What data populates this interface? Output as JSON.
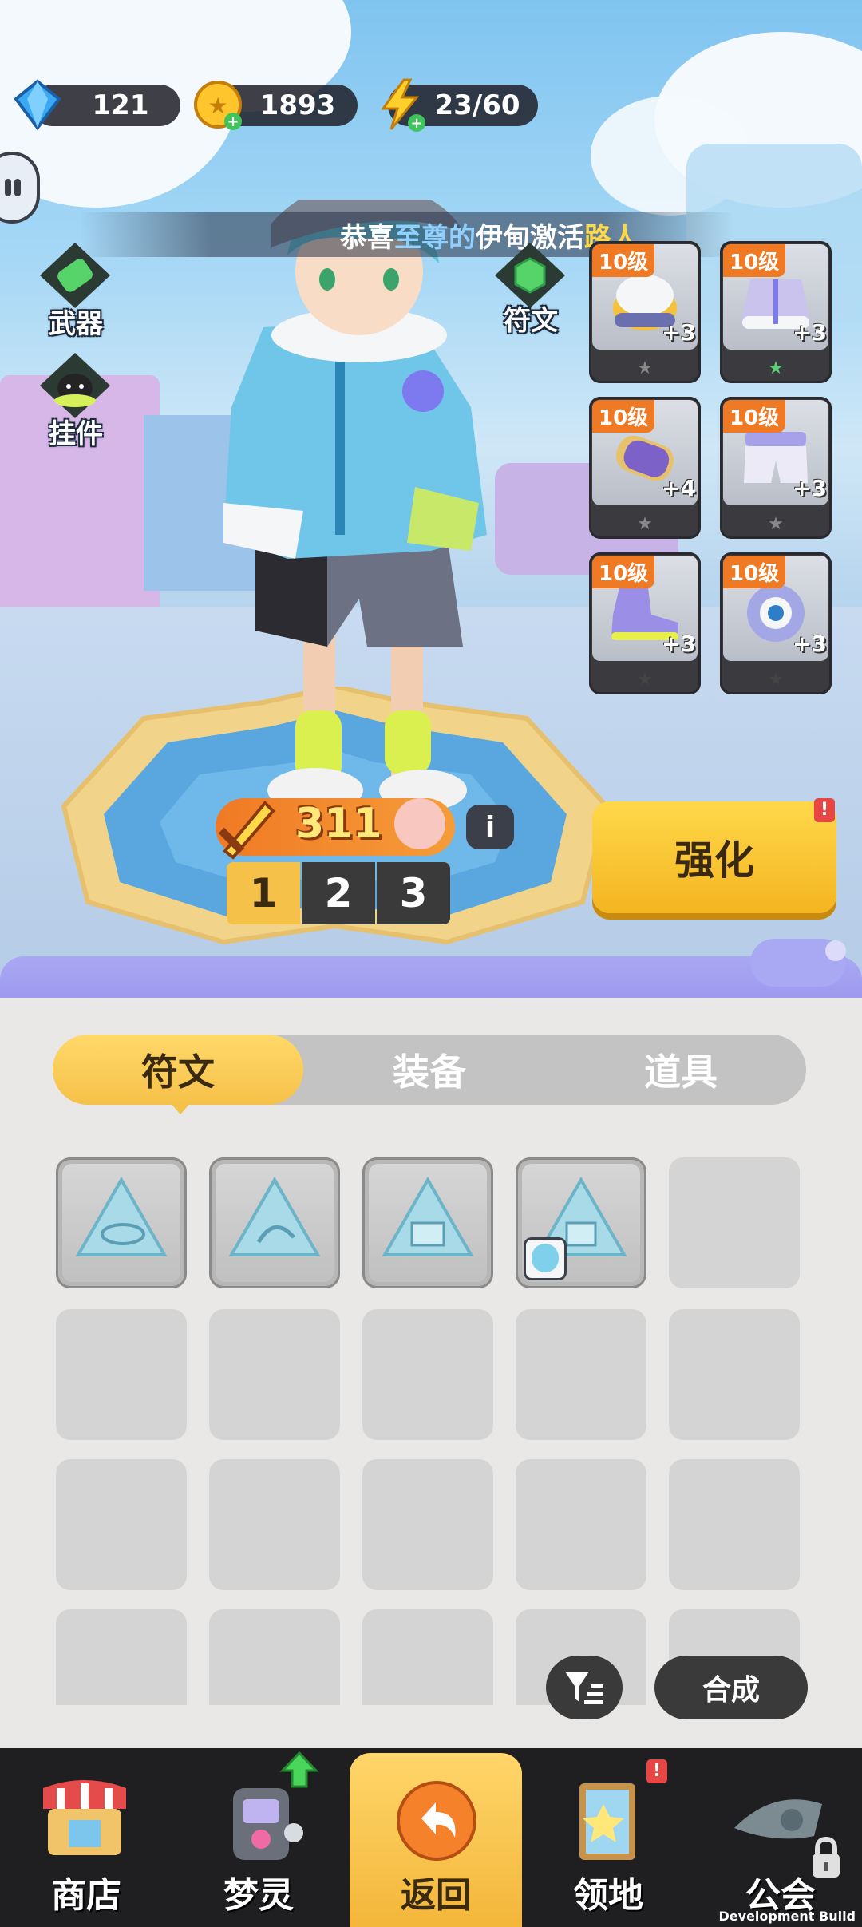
{
  "resources": {
    "gems": "121",
    "coins": "1893",
    "energy": "23/60"
  },
  "ticker": {
    "p1": "恭喜",
    "p2": "至尊的",
    "p3": "伊甸",
    "p4": "激活",
    "p5": "路人"
  },
  "left_buttons": {
    "weapon": "武器",
    "pendant": "挂件",
    "rune": "符文"
  },
  "equipment": [
    {
      "level": "10级",
      "plus": "+3",
      "icon": "helmet-icon"
    },
    {
      "level": "10级",
      "plus": "+3",
      "icon": "jacket-icon"
    },
    {
      "level": "10级",
      "plus": "+4",
      "icon": "bracer-icon"
    },
    {
      "level": "10级",
      "plus": "+3",
      "icon": "shorts-icon"
    },
    {
      "level": "10级",
      "plus": "+3",
      "icon": "shoe-icon"
    },
    {
      "level": "10级",
      "plus": "+3",
      "icon": "eye-orb-icon"
    }
  ],
  "power": {
    "value": "311",
    "info": "i"
  },
  "loadouts": [
    "1",
    "2",
    "3"
  ],
  "enhance_label": "强化",
  "enhance_badge": "!",
  "tabs": [
    "符文",
    "装备",
    "道具"
  ],
  "actions": {
    "compose": "合成"
  },
  "nav": {
    "shop": "商店",
    "dream": "梦灵",
    "back": "返回",
    "territory": "领地",
    "guild": "公会"
  },
  "footer": "Development Build",
  "colors": {
    "accent_yellow": "#f6c149",
    "panel_lilac": "#9b98ee",
    "level_orange": "#f07a24"
  }
}
